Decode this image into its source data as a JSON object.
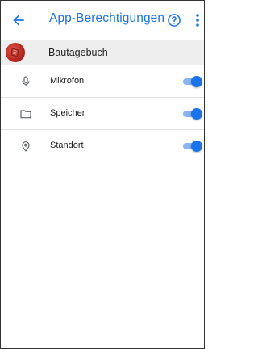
{
  "toolbar": {
    "title": "App-Berechtigungen",
    "accent_color": "#1a73e8",
    "back_icon": "arrow-left-icon",
    "help_icon": "help-circle-icon",
    "more_icon": "more-vert-icon"
  },
  "app": {
    "name": "Bautagebuch",
    "icon": "app-logo-icon"
  },
  "permissions": [
    {
      "label": "Mikrofon",
      "icon": "microphone-icon",
      "enabled": true
    },
    {
      "label": "Speicher",
      "icon": "folder-icon",
      "enabled": true
    },
    {
      "label": "Standort",
      "icon": "location-pin-icon",
      "enabled": true
    }
  ]
}
